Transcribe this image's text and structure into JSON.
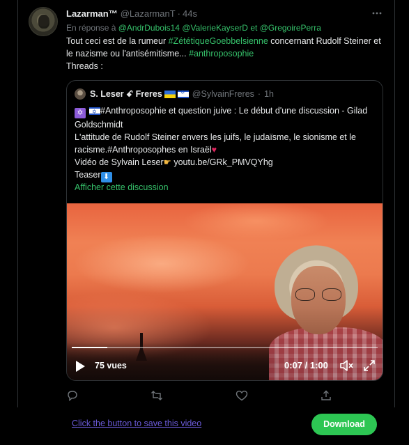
{
  "tweet": {
    "display_name": "Lazarman™",
    "handle": "@LazarmanT",
    "separator": "·",
    "time": "44s",
    "reply_prefix": "En réponse à",
    "reply_mentions": [
      "@AndrDubois14",
      "@ValerieKayserD",
      "et",
      "@GregoirePerra"
    ],
    "text_part1": "Tout ceci est de la rumeur ",
    "text_hashtag1": "#ZététiqueGoebbelsienne",
    "text_part2": " concernant Rudolf Steiner et le nazisme ou l'antisémitisme...  ",
    "text_hashtag2": "#anthroposophie",
    "text_line3": "Threads :"
  },
  "quote": {
    "display_name": "S. Leser ꗃ Freres",
    "handle": "@SylvainFreres",
    "separator": "·",
    "time": "1h",
    "line1": "#Anthroposophie et question juive : Le début d'une discussion - Gilad Goldschmidt",
    "line2": "L'attitude de Rudolf Steiner envers les juifs, le judaïsme, le sionisme et le racisme.#Anthroposophes en Israël",
    "line3_prefix": "Vidéo de Sylvain Leser",
    "line3_link": " youtu.be/GRk_PMVQYhg",
    "line4": "Teaser",
    "show_thread": "Afficher cette discussion"
  },
  "video": {
    "views": "75 vues",
    "time_readout": "0:07 / 1:00",
    "progress_fraction": 0.117
  },
  "download": {
    "save_link": "Click the button to save this video",
    "button_label": "Download"
  },
  "icons": {
    "more": "more-horizontal-icon",
    "reply": "reply-icon",
    "retweet": "retweet-icon",
    "like": "like-icon",
    "share": "share-icon",
    "play": "play-icon",
    "volume": "volume-icon",
    "fullscreen": "fullscreen-icon"
  },
  "colors": {
    "accent_link": "#36c26b",
    "download_button": "#2dc653",
    "save_link": "#6a5ad8",
    "muted": "#71767b"
  }
}
